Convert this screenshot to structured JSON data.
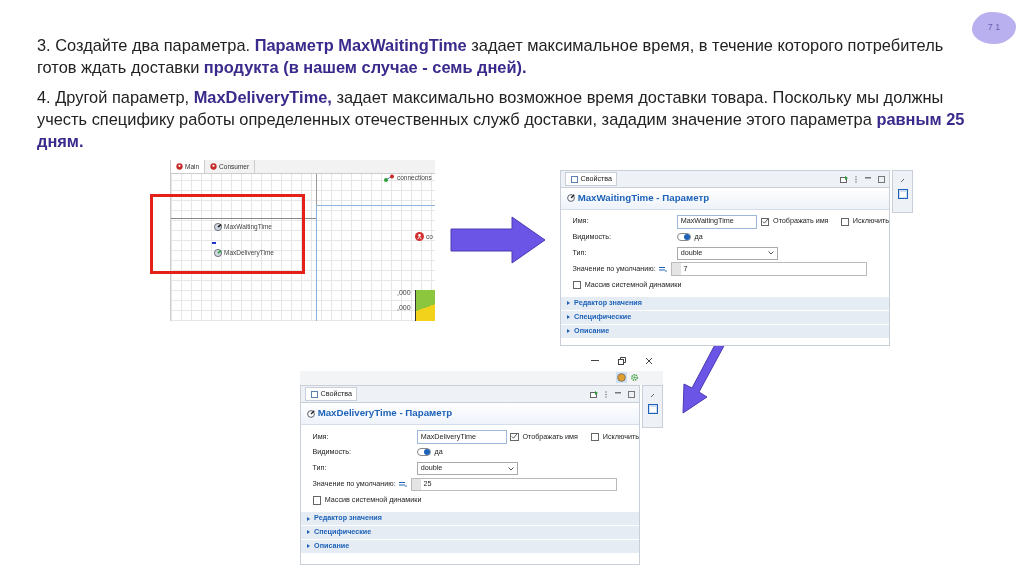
{
  "slide_number": "7 1",
  "paragraphs": [
    "3. Создайте два параметра. **Параметр MaxWaitingTime** задает максимальное время, в течение которого потребитель готов ждать доставки **продукта (в нашем случае - семь дней).**",
    "4. Другой параметр, **MaxDeliveryTime,** задает максимально возможное время доставки товара. Поскольку мы должны учесть специфику работы определенных отечественных служб доставки, зададим значение этого параметра **равным 25 дням.**"
  ],
  "editor": {
    "tabs": [
      {
        "label": "Main",
        "selected": true
      },
      {
        "label": "Consumer",
        "selected": false
      }
    ],
    "connections_label": "connections",
    "cut_label": "co",
    "parameters": [
      "MaxWaitingTime",
      "MaxDeliveryTime"
    ],
    "axis_labels": [
      ",000",
      ",000"
    ]
  },
  "property_panels": [
    {
      "window_bar": false,
      "tab": "Свойства",
      "title": "MaxWaitingTime - Параметр",
      "name_label": "Имя:",
      "name_value": "MaxWaitingTime",
      "show_name": {
        "label": "Отображать имя",
        "checked": true
      },
      "exclude": {
        "label": "Исключить",
        "checked": false
      },
      "visibility_label": "Видимость:",
      "visibility": {
        "label": "да",
        "on": true
      },
      "type_label": "Тип:",
      "type_value": "double",
      "default_label": "Значение по умолчанию:",
      "default_value": "7",
      "sd_array": {
        "label": "Массив системной динамики",
        "checked": false
      },
      "sections": [
        "Редактор значения",
        "Специфические",
        "Описание"
      ]
    },
    {
      "window_bar": true,
      "tab": "Свойства",
      "title": "MaxDeliveryTime - Параметр",
      "name_label": "Имя:",
      "name_value": "MaxDeliveryTime",
      "show_name": {
        "label": "Отображать имя",
        "checked": true
      },
      "exclude": {
        "label": "Исключить",
        "checked": false
      },
      "visibility_label": "Видимость:",
      "visibility": {
        "label": "да",
        "on": true
      },
      "type_label": "Тип:",
      "type_value": "double",
      "default_label": "Значение по умолчанию:",
      "default_value": "25",
      "sd_array": {
        "label": "Массив системной динамики",
        "checked": false
      },
      "sections": [
        "Редактор значения",
        "Специфические",
        "Описание"
      ]
    }
  ]
}
